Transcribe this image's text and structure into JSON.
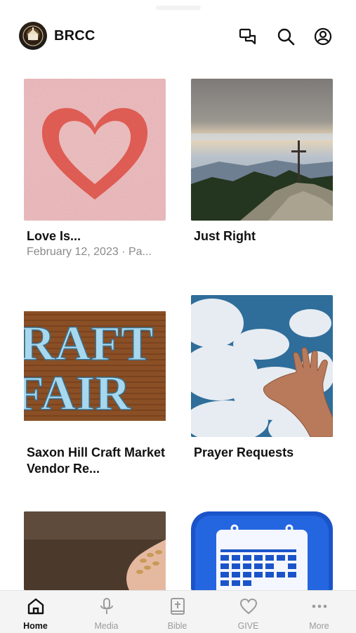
{
  "header": {
    "app_title": "BRCC",
    "icons": [
      "chat-icon",
      "search-icon",
      "profile-icon"
    ]
  },
  "cards": [
    {
      "title": "Love Is...",
      "subtitle": "February 12, 2023 · Pa...",
      "image": "heart-glitter"
    },
    {
      "title": "Just Right",
      "subtitle": "",
      "image": "mountain-cross"
    },
    {
      "title": "Saxon Hill Craft Market Vendor Re...",
      "subtitle": "",
      "image": "craft-fair"
    },
    {
      "title": "Prayer Requests",
      "subtitle": "",
      "image": "hand-clouds"
    },
    {
      "title": "",
      "subtitle": "",
      "image": "seeds-hand"
    },
    {
      "title": "",
      "subtitle": "",
      "image": "calendar"
    }
  ],
  "craft_fair_text": {
    "line1": "RAFT",
    "line2": "FAIR"
  },
  "tabbar": {
    "tabs": [
      {
        "label": "Home",
        "icon": "home-icon",
        "active": true
      },
      {
        "label": "Media",
        "icon": "microphone-icon",
        "active": false
      },
      {
        "label": "Bible",
        "icon": "bible-icon",
        "active": false
      },
      {
        "label": "GIVE",
        "icon": "heart-icon",
        "active": false
      },
      {
        "label": "More",
        "icon": "more-icon",
        "active": false
      }
    ]
  },
  "colors": {
    "accent": "#111111",
    "inactive": "#9b9b9b",
    "tabbar_bg": "#f4f4f4"
  }
}
